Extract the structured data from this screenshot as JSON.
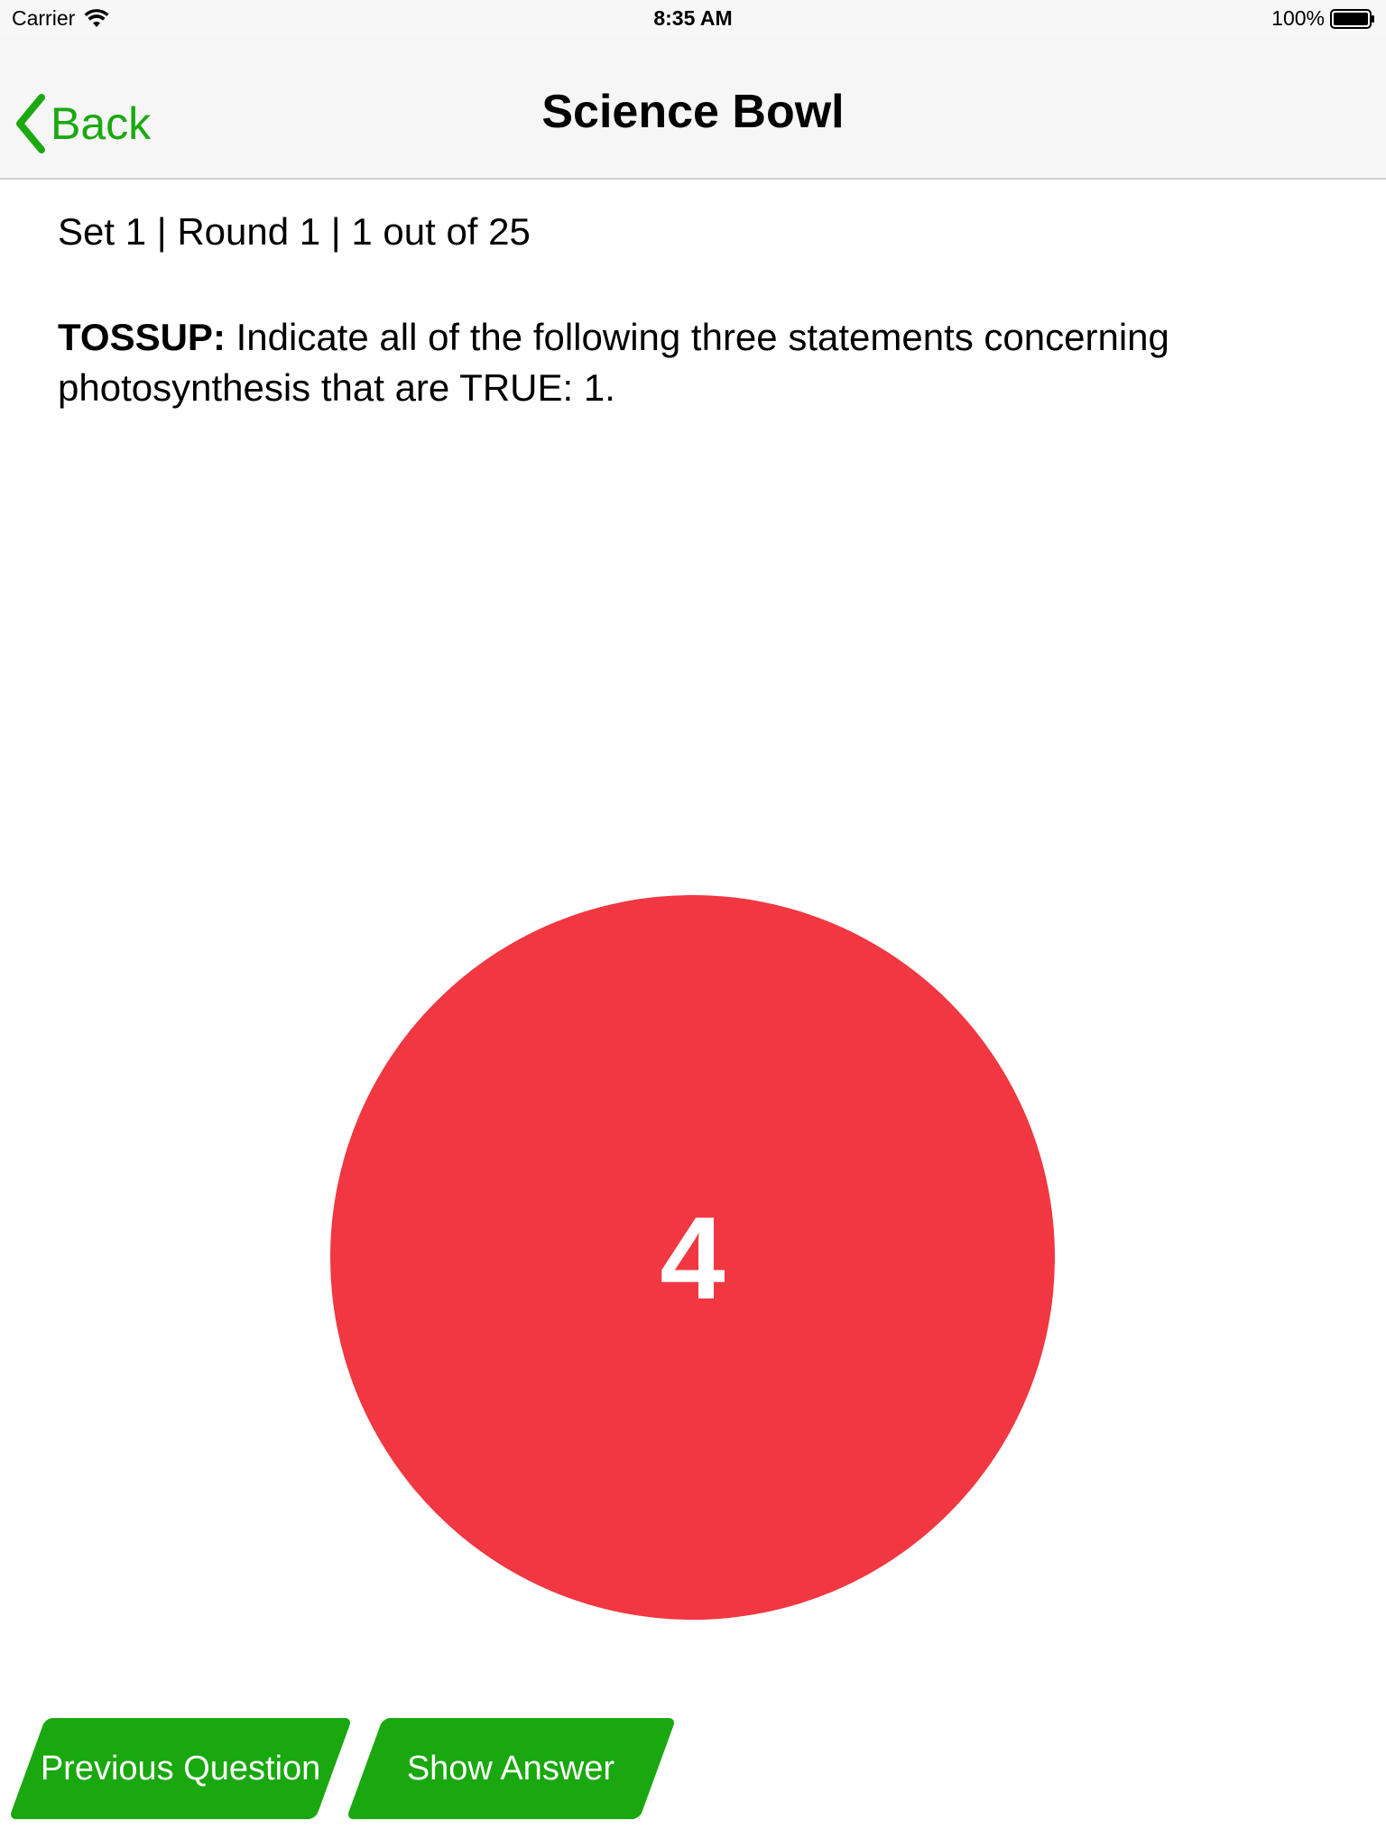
{
  "status_bar": {
    "carrier": "Carrier",
    "time": "8:35 AM",
    "battery": "100%"
  },
  "nav": {
    "back_label": "Back",
    "title": "Science Bowl"
  },
  "question": {
    "meta": "Set 1 | Round 1 | 1 out of 25",
    "label": "TOSSUP:",
    "text": "Indicate all of the following three statements concerning photosynthesis that are TRUE: 1."
  },
  "timer": {
    "value": "4",
    "color": "#f13741"
  },
  "buttons": {
    "previous": "Previous Question",
    "show_answer": "Show Answer"
  },
  "colors": {
    "accent": "#1aa90f",
    "button_bg": "#19a80f"
  },
  "icons": {
    "wifi": "wifi-icon",
    "battery": "battery-icon",
    "back": "chevron-left-icon"
  }
}
